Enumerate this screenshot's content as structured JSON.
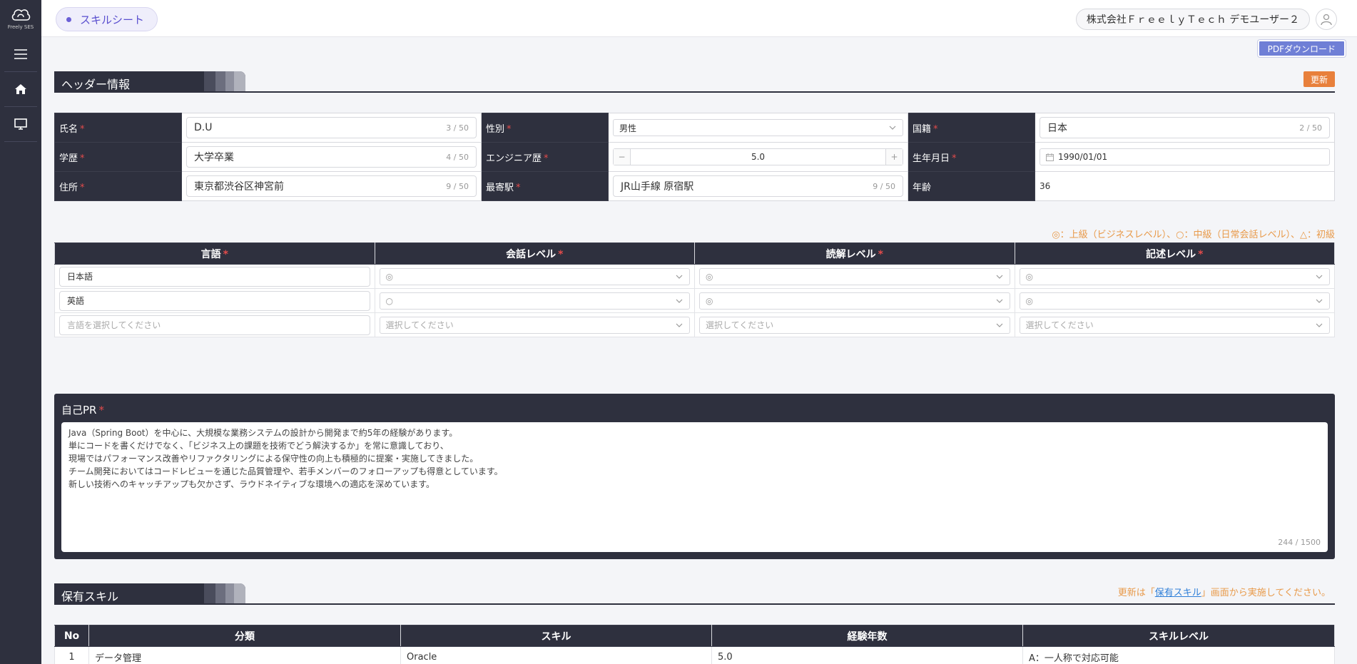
{
  "sidebar": {
    "logo_text": "Freely SES"
  },
  "header": {
    "page_title": "スキルシート",
    "user": "株式会社ＦｒｅｅｌｙＴｅｃｈ デモユーザー２",
    "pdf_button": "PDFダウンロード"
  },
  "header_info": {
    "section_title": "ヘッダー情報",
    "update_button": "更新",
    "fields": {
      "name": {
        "label": "氏名",
        "value": "D.U",
        "count": "3 / 50"
      },
      "gender": {
        "label": "性別",
        "value": "男性"
      },
      "nationality": {
        "label": "国籍",
        "value": "日本",
        "count": "2 / 50"
      },
      "education": {
        "label": "学歴",
        "value": "大学卒業",
        "count": "4 / 50"
      },
      "engineer_years": {
        "label": "エンジニア歴",
        "value": "5.0",
        "minus": "−",
        "plus": "+"
      },
      "birthday": {
        "label": "生年月日",
        "value": "1990/01/01"
      },
      "address": {
        "label": "住所",
        "value": "東京都渋谷区神宮前",
        "count": "9 / 50"
      },
      "station": {
        "label": "最寄駅",
        "value": "JR山手線 原宿駅",
        "count": "9 / 50"
      },
      "age": {
        "label": "年齢",
        "value": "36"
      }
    }
  },
  "languages": {
    "legend": "◎：上級（ビジネスレベル）、○：中級（日常会話レベル）、△：初級",
    "headers": {
      "language": "言語",
      "speaking": "会話レベル",
      "reading": "読解レベル",
      "writing": "記述レベル"
    },
    "rows": [
      {
        "language": "日本語",
        "speaking": "◎",
        "reading": "◎",
        "writing": "◎"
      },
      {
        "language": "英語",
        "speaking": "○",
        "reading": "◎",
        "writing": "◎"
      }
    ],
    "new_row": {
      "language_placeholder": "言語を選択してください",
      "select_placeholder": "選択してください"
    }
  },
  "self_pr": {
    "title": "自己PR",
    "lines": [
      "Java（Spring Boot）を中心に、大規模な業務システムの設計から開発まで約5年の経験があります。",
      "単にコードを書くだけでなく、「ビジネス上の課題を技術でどう解決するか」を常に意識しており、",
      "現場ではパフォーマンス改善やリファクタリングによる保守性の向上も積極的に提案・実施してきました。",
      "チーム開発においてはコードレビューを通じた品質管理や、若手メンバーのフォローアップも得意としています。",
      "新しい技術へのキャッチアップも欠かさず、ラウドネイティブな環境への適応を深めています。"
    ],
    "count": "244 / 1500"
  },
  "skills": {
    "section_title": "保有スキル",
    "note_prefix": "更新は「",
    "note_link": "保有スキル",
    "note_suffix": "」画面から実施してください。",
    "headers": {
      "no": "No",
      "category": "分類",
      "skill": "スキル",
      "years": "経験年数",
      "level": "スキルレベル"
    },
    "rows": [
      {
        "no": "1",
        "category": "データ管理",
        "skill": "Oracle",
        "years": "5.0",
        "level": "A：一人称で対応可能"
      }
    ]
  },
  "colors": {
    "dark": "#2e303e",
    "accent": "#6a5fd6",
    "orange": "#e8803c",
    "note": "#e89a4a",
    "required": "#e24b4b"
  }
}
